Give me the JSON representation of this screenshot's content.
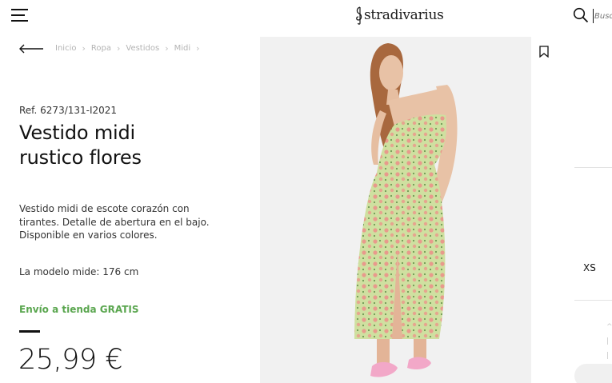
{
  "header": {
    "logo_text": "stradivarius",
    "search_placeholder": "Busca"
  },
  "breadcrumb": {
    "items": [
      "Inicio",
      "Ropa",
      "Vestidos",
      "Midi"
    ]
  },
  "product": {
    "ref": "Ref. 6273/131-I2021",
    "title_line1": "Vestido midi",
    "title_line2": "rustico flores",
    "description": "Vestido midi de escote corazón con tirantes. Detalle de abertura en el bajo. Disponible en varios colores.",
    "model_height": "La modelo mide: 176 cm",
    "shipping": "Envío a tienda GRATIS",
    "price": "25,99 €"
  },
  "sizes": {
    "visible": "XS"
  },
  "colors": {
    "shipping_green": "#5aa64f",
    "dress_green": "#cfe0a0",
    "flower_pink": "#e89a8c",
    "sandal_pink": "#f2a8c8"
  },
  "icons": {
    "menu": "menu-icon",
    "search": "search-icon",
    "back": "arrow-left-icon",
    "bookmark": "bookmark-icon",
    "logo": "clef-icon"
  }
}
